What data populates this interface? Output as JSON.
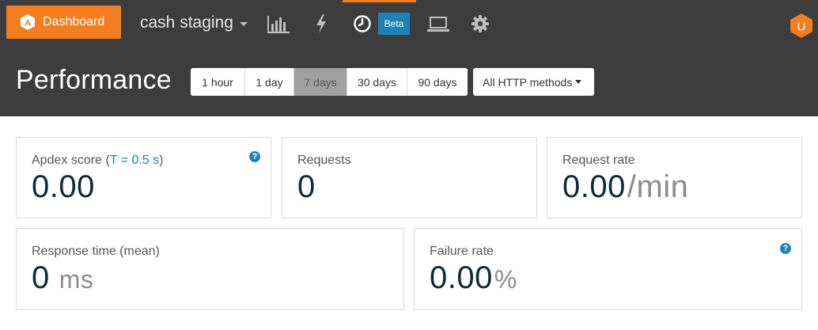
{
  "nav": {
    "dashboard_label": "Dashboard",
    "dashboard_logo_letter": "A",
    "app_name": "cash staging",
    "icons": [
      "bar-chart-icon",
      "lightning-icon",
      "clock-icon",
      "laptop-icon",
      "gear-icon"
    ],
    "beta_badge": "Beta",
    "user_initial": "U",
    "accent_color": "#f47d20",
    "badge_color": "#1e81b9"
  },
  "header": {
    "title": "Performance",
    "ranges": [
      "1 hour",
      "1 day",
      "7 days",
      "30 days",
      "90 days"
    ],
    "selected_range": "7 days",
    "method_filter": "All HTTP methods"
  },
  "metrics": {
    "apdex": {
      "label": "Apdex score (",
      "threshold": "T = 0.5 s",
      "label_close": ")",
      "value": "0.00"
    },
    "requests": {
      "label": "Requests",
      "value": "0"
    },
    "request_rate": {
      "label": "Request rate",
      "value": "0.00",
      "unit": "/min"
    },
    "response_time": {
      "label": "Response time (mean)",
      "value": "0",
      "unit": "ms"
    },
    "failure_rate": {
      "label": "Failure rate",
      "value": "0.00",
      "unit": "%"
    },
    "help_glyph": "?"
  }
}
